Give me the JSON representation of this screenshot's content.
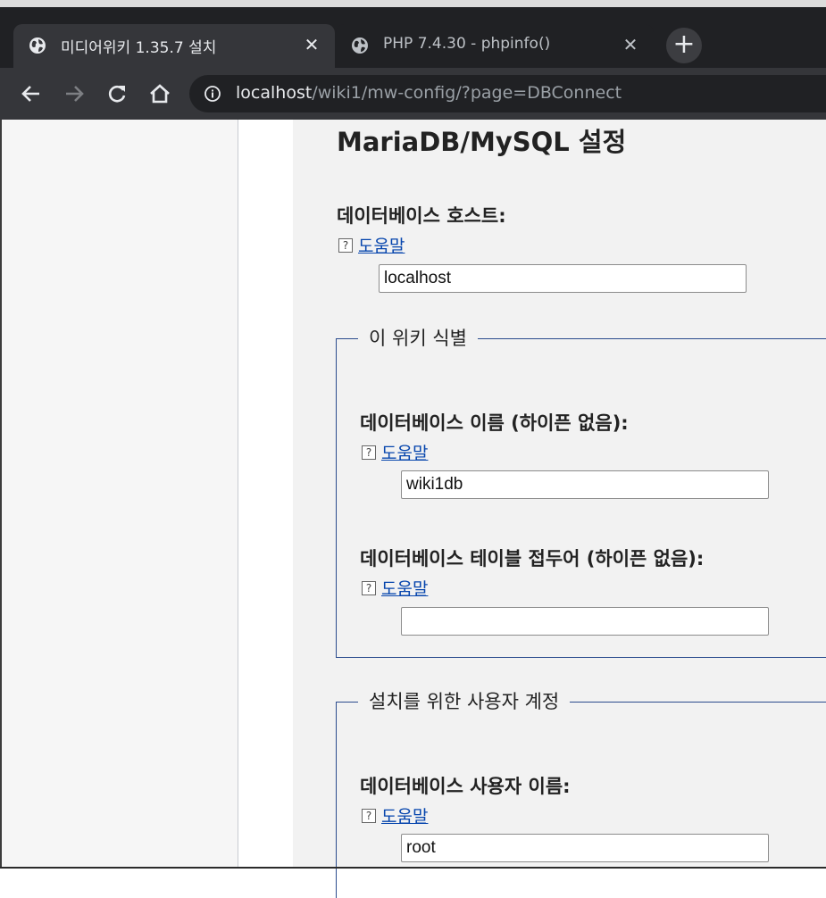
{
  "browser": {
    "tabs": [
      {
        "title": "미디어위키 1.35.7 설치",
        "active": true
      },
      {
        "title": "PHP 7.4.30 - phpinfo()",
        "active": false
      }
    ],
    "url": {
      "host": "localhost",
      "path": "/wiki1/mw-config/?page=DBConnect"
    },
    "icons": [
      "back-arrow-icon",
      "forward-arrow-icon",
      "reload-icon",
      "home-icon",
      "info-icon",
      "globe-icon",
      "close-icon",
      "plus-icon"
    ]
  },
  "page": {
    "heading": "MariaDB/MySQL 설정",
    "db_host": {
      "label": "데이터베이스 호스트:",
      "help": "도움말",
      "value": "localhost"
    },
    "wiki_ident": {
      "legend": "이 위키 식별",
      "db_name": {
        "label": "데이터베이스 이름 (하이픈 없음):",
        "help": "도움말",
        "value": "wiki1db"
      },
      "table_prefix": {
        "label": "데이터베이스 테이블 접두어 (하이픈 없음):",
        "help": "도움말",
        "value": ""
      }
    },
    "install_account": {
      "legend": "설치를 위한 사용자 계정",
      "db_user": {
        "label": "데이터베이스 사용자 이름:",
        "help": "도움말",
        "value": "root"
      }
    },
    "help_icon_glyph": "?"
  },
  "colors": {
    "link": "#0645ad",
    "fieldset_border": "#2a4b8d",
    "content_bg": "#f2f2f2",
    "chrome_dark": "#202124",
    "chrome_tab": "#35363a"
  }
}
